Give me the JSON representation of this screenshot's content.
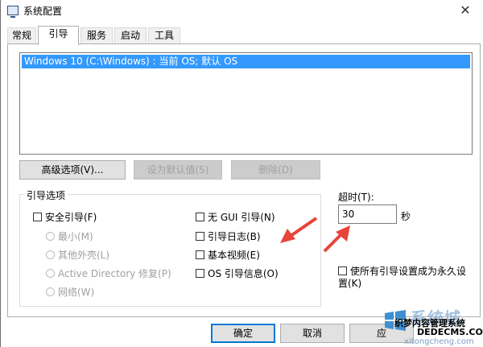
{
  "window": {
    "title": "系统配置",
    "close_glyph": "✕"
  },
  "tabs": [
    {
      "label": "常规"
    },
    {
      "label": "引导"
    },
    {
      "label": "服务"
    },
    {
      "label": "启动"
    },
    {
      "label": "工具"
    }
  ],
  "active_tab": "引导",
  "os_list": {
    "items": [
      {
        "label": "Windows 10 (C:\\Windows) : 当前 OS; 默认 OS",
        "selected": true
      }
    ]
  },
  "buttons": {
    "advanced": "高级选项(V)...",
    "set_default": "设为默认值(S)",
    "delete": "删除(D)"
  },
  "boot_options": {
    "legend": "引导选项",
    "safe_boot": "安全引导(F)",
    "minimal": "最小(M)",
    "alternate_shell": "其他外壳(L)",
    "active_directory": "Active Directory 修复(P)",
    "network": "网络(W)",
    "no_gui": "无 GUI 引导(N)",
    "boot_log": "引导日志(B)",
    "base_video": "基本视频(E)",
    "os_boot_info": "OS 引导信息(O)"
  },
  "timeout": {
    "label": "超时(T):",
    "value": "30",
    "unit": "秒"
  },
  "make_permanent": "使所有引导设置成为永久设置(K)",
  "footer": {
    "ok": "确定",
    "cancel": "取消",
    "apply": "应"
  },
  "watermark": {
    "big": "系统城",
    "line1": "织梦内容管理系统",
    "line2": "DEDECMS.COM",
    "line3": "xitongcheng.com"
  },
  "colors": {
    "selection": "#3399ff",
    "arrow": "#e8443a",
    "default_button_border": "#0078d7"
  }
}
